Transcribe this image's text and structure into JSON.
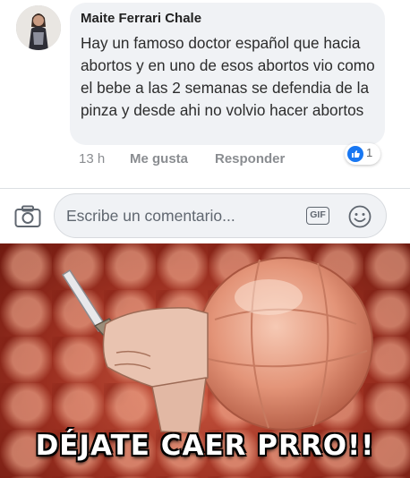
{
  "comment": {
    "author": "Maite Ferrari Chale",
    "text": "Hay un famoso doctor español que hacia abortos y en uno de esos abortos vio como el bebe a las 2 semanas se defendia de la pinza y desde ahi no volvio hacer abortos",
    "time": "13 h",
    "like_label": "Me gusta",
    "reply_label": "Responder",
    "reaction_count": "1",
    "reaction_icon": "thumbs-up-icon"
  },
  "composer": {
    "placeholder": "Escribe un comentario...",
    "gif_label": "GIF",
    "camera_icon": "camera-icon",
    "emoji_icon": "smiley-icon"
  },
  "meme": {
    "caption": "DÉJATE CAER PRRO!!"
  },
  "colors": {
    "bubble": "#f0f2f5",
    "secondary_text": "#8a8d91",
    "like_blue": "#1877f2",
    "meme_flesh": "#c9563f"
  }
}
